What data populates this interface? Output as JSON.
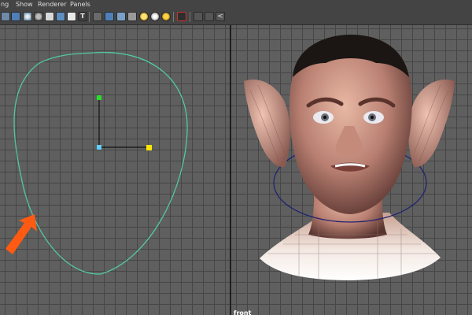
{
  "menus": [
    "ng",
    "Show",
    "Renderer",
    "Panels"
  ],
  "toolbar": {
    "icons": [
      "grid-icon",
      "camera-icon",
      "sphere-icon",
      "sphere-solid-icon",
      "xray-icon",
      "image-plane-icon",
      "texture-icon",
      "text-icon",
      "cube-icon",
      "cube-solid-icon",
      "cube-textured-icon",
      "cube-wire-icon",
      "light-default-icon",
      "light-all-icon",
      "light-selected-icon",
      "isolate-icon",
      "panel-layout-icon",
      "share-icon"
    ]
  },
  "viewport": {
    "camera_label": "front",
    "grid_color": "#464646",
    "background": "#5f5f5f",
    "curve_color": "#53c7a0",
    "ring_color": "#1f2370",
    "arrow_color": "#ff5a12",
    "manipulator": {
      "x_color": "#ffe600",
      "y_color": "#28e028",
      "center_color": "#5fd0ff"
    }
  }
}
